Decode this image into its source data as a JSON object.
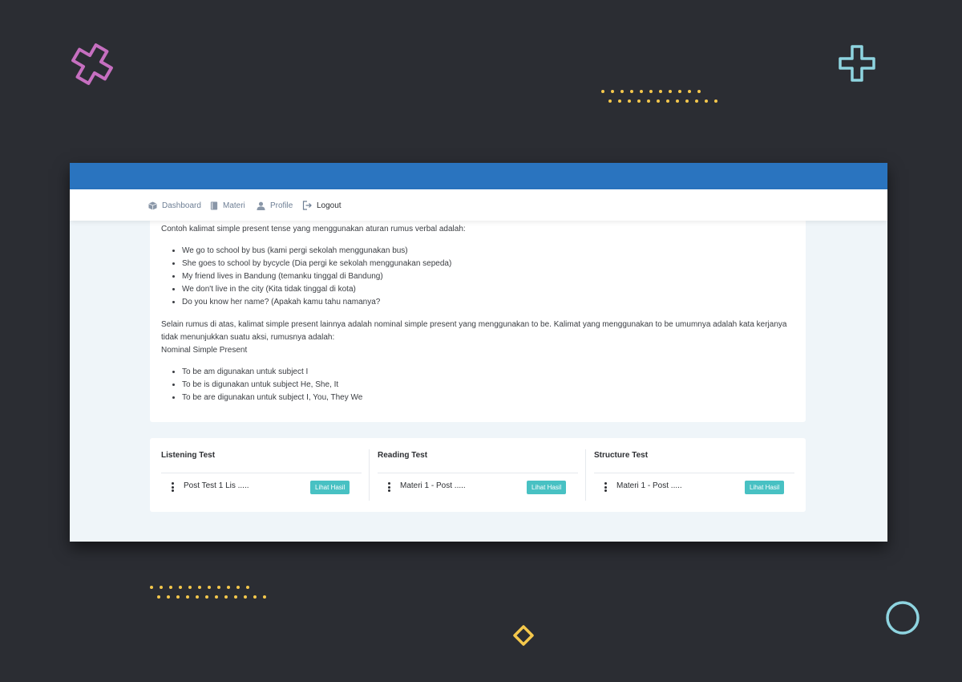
{
  "colors": {
    "background": "#2b2d33",
    "topbar": "#2a74bf",
    "content_bg": "#eff5f9",
    "button": "#48c1c3",
    "deco_pink": "#c66fc0",
    "deco_cyan": "#8ed4e0",
    "deco_yellow": "#f5c84c"
  },
  "nav": {
    "items": [
      {
        "label": "Dashboard",
        "icon": "box-icon"
      },
      {
        "label": "Materi",
        "icon": "book-icon"
      },
      {
        "label": "Profile",
        "icon": "user-icon"
      },
      {
        "label": "Logout",
        "icon": "logout-icon"
      }
    ]
  },
  "content": {
    "intro": "Contoh kalimat simple present tense yang menggunakan aturan rumus verbal adalah:",
    "examples": [
      "We go to school by bus (kami pergi sekolah menggunakan bus)",
      "She goes to school by bycycle (Dia pergi ke sekolah menggunakan sepeda)",
      "My friend lives in Bandung (temanku tinggal di Bandung)",
      "We don't live in the city (Kita tidak tinggal di kota)",
      "Do you know her name? (Apakah kamu tahu namanya?"
    ],
    "paragraph2": "Selain rumus di atas, kalimat simple present lainnya adalah nominal simple present yang menggunakan to be. Kalimat yang menggunakan to be umumnya adalah kata kerjanya tidak menunjukkan suatu aksi, rumusnya adalah:",
    "nominal_title": "Nominal Simple Present",
    "to_be": [
      "To be am digunakan untuk subject I",
      "To be is digunakan untuk subject He, She, It",
      "To be are digunakan untuk subject I, You, They We"
    ]
  },
  "tests": [
    {
      "title": "Listening Test",
      "item": "Post Test 1 Lis .....",
      "button": "Lihat Hasil"
    },
    {
      "title": "Reading Test",
      "item": "Materi 1 - Post .....",
      "button": "Lihat Hasil"
    },
    {
      "title": "Structure Test",
      "item": "Materi 1 - Post .....",
      "button": "Lihat Hasil"
    }
  ]
}
